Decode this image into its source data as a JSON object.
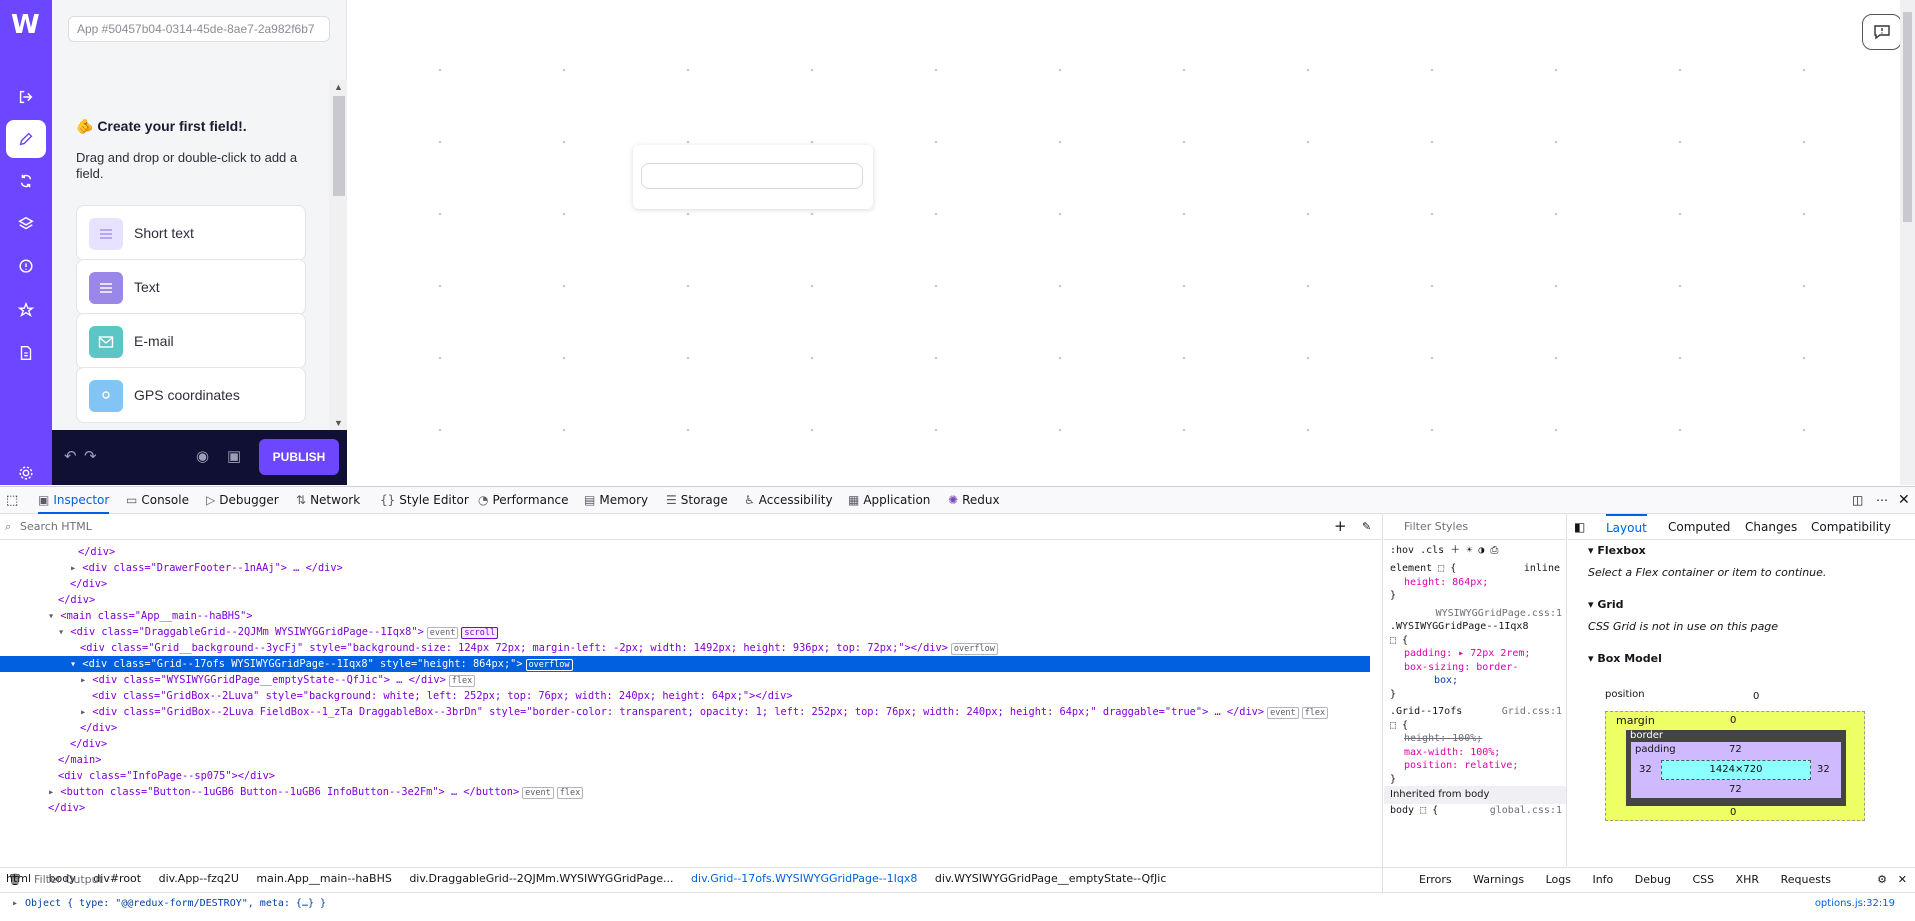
{
  "app": {
    "app_id_placeholder": "App #50457b04-0314-45de-8ae7-2a982f6b7",
    "create_title": "🫵 Create your first field!.",
    "create_subtitle": "Drag and drop or double-click to add a field.",
    "fields": [
      {
        "label": "Short text",
        "color": "#e8e1ff",
        "icon": "short-text-icon"
      },
      {
        "label": "Text",
        "color": "#9b87e8",
        "icon": "text-icon"
      },
      {
        "label": "E-mail",
        "color": "#5cc6c6",
        "icon": "email-icon"
      },
      {
        "label": "GPS coordinates",
        "color": "#82c5f5",
        "icon": "gps-icon"
      }
    ],
    "publish_label": "PUBLISH",
    "logo": "W"
  },
  "devtools": {
    "tabs": [
      "Inspector",
      "Console",
      "Debugger",
      "Network",
      "Style Editor",
      "Performance",
      "Memory",
      "Storage",
      "Accessibility",
      "Application",
      "Redux"
    ],
    "search_html_placeholder": "Search HTML",
    "tree": [
      "</div>",
      "<div class=\"DrawerFooter--1nAAj\"> … </div>",
      "</div>",
      "</div>",
      "<main class=\"App__main--haBHS\">",
      "<div class=\"DraggableGrid--2QJMm WYSIWYGGridPage--1Iqx8\">",
      "<div class=\"Grid__background--3ycFj\" style=\"background-size: 124px 72px; margin-left: -2px; width: 1492px; height: 936px; top: 72px;\"></div>",
      "<div class=\"Grid--17ofs WYSIWYGGridPage--1Iqx8\" style=\"height: 864px;\">",
      "<div class=\"WYSIWYGGridPage__emptyState--QfJic\"> … </div>",
      "<div class=\"GridBox--2Luva\" style=\"background: white; left: 252px; top: 76px; width: 240px; height: 64px;\"></div>",
      "<div class=\"GridBox--2Luva FieldBox--1_zTa DraggableBox--3brDn\" style=\"border-color: transparent; opacity: 1; left: 252px; top: 76px; width: 240px; height: 64px;\" draggable=\"true\"> … </div>",
      "</div>",
      "</div>",
      "</main>",
      "<div class=\"InfoPage--sp075\"></div>",
      "<button class=\"Button--1uGB6 Button--1uGB6 InfoButton--3e2Fm\"> … </button>",
      "</div>"
    ],
    "badges": {
      "event": "event",
      "scroll": "scroll",
      "overflow": "overflow",
      "flex": "flex"
    },
    "breadcrumbs": [
      "html",
      "body",
      "div#root",
      "div.App--fzq2U",
      "main.App__main--haBHS",
      "div.DraggableGrid--2QJMm.WYSIWYGGridPage...",
      "div.Grid--17ofs.WYSIWYGGridPage--1Iqx8",
      "div.WYSIWYGGridPage__emptyState--QfJic"
    ],
    "styles": {
      "filter_placeholder": "Filter Styles",
      "hov": ":hov",
      "cls": ".cls",
      "element_rule": "element ⬚ {",
      "inline": "inline",
      "element_prop": "height: 864px;",
      "src1": "WYSIWYGGridPage.css:1",
      "sel1": ".WYSIWYGGridPage--1Iqx8",
      "p1": "padding: ▸ 72px 2rem;",
      "p2": "box-sizing: border-",
      "p2b": "box;",
      "sel2": ".Grid--17ofs",
      "src2": "Grid.css:1",
      "p3": "height: 100%;",
      "p4": "max-width: 100%;",
      "p5": "position: relative;",
      "inherited": "Inherited from body",
      "body_rule": "body ⬚ {",
      "src3": "global.css:1"
    },
    "layout": {
      "tabs": [
        "Layout",
        "Computed",
        "Changes",
        "Compatibility"
      ],
      "flexbox": "Flexbox",
      "flexbox_note": "Select a Flex container or item to continue.",
      "grid": "Grid",
      "grid_note": "CSS Grid is not in use on this page",
      "box_model": "Box Model",
      "position": "position",
      "margin": "margin",
      "border": "border",
      "padding": "padding",
      "content": "1424×720",
      "pad_top": "72",
      "pad_bottom": "72",
      "pad_side": "32",
      "zero": "0"
    },
    "console": {
      "filter_placeholder": "Filter Output",
      "levels": [
        "Errors",
        "Warnings",
        "Logs",
        "Info",
        "Debug"
      ],
      "right": [
        "CSS",
        "XHR",
        "Requests"
      ],
      "log": "Object { type: \"@@redux-form/DESTROY\", meta: {…} }",
      "source": "options.js:32:19"
    }
  }
}
